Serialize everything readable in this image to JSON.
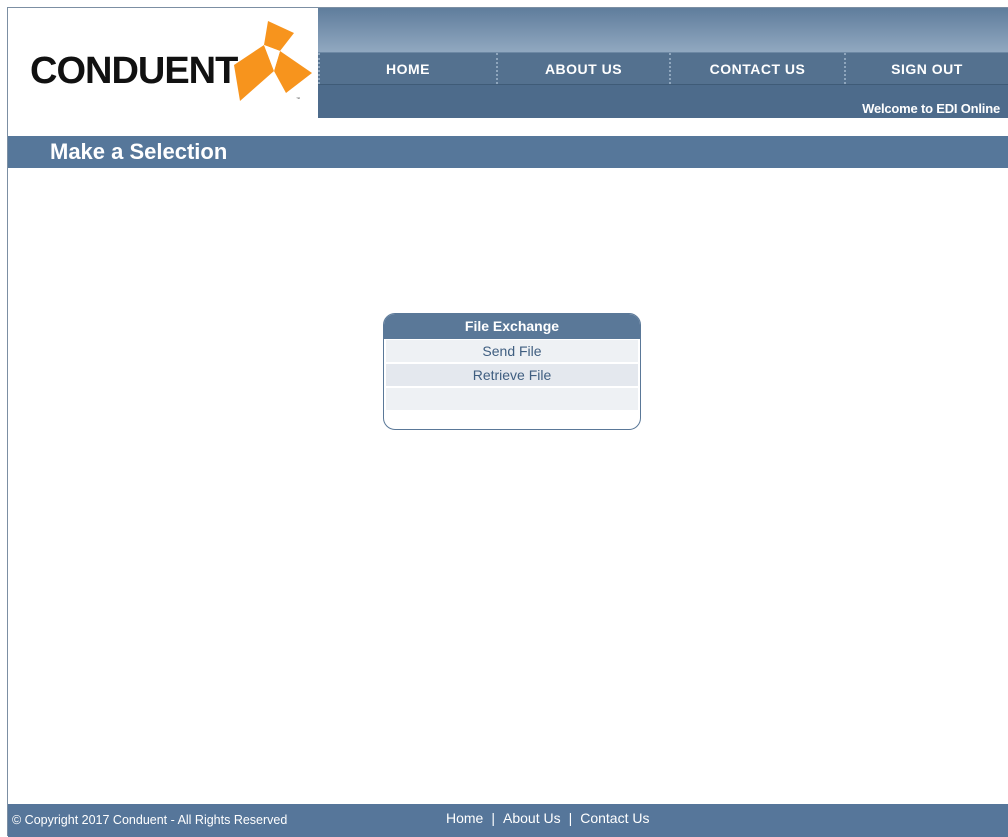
{
  "header": {
    "logo_text": "CONDUENT",
    "logo_tm": "™",
    "welcome": "Welcome to EDI Online",
    "nav": [
      "HOME",
      "ABOUT US",
      "CONTACT US",
      "SIGN OUT"
    ]
  },
  "page": {
    "title": "Make a Selection"
  },
  "menu": {
    "heading": "File Exchange",
    "items": [
      "Send File",
      "Retrieve File",
      ""
    ]
  },
  "footer": {
    "copyright": "© Copyright 2017 Conduent - All Rights Reserved",
    "links": [
      "Home",
      "About Us",
      "Contact Us"
    ],
    "separator": "|"
  },
  "colors": {
    "brand_orange": "#f7941d",
    "nav_blue": "#54718f",
    "title_blue": "#56779a"
  }
}
